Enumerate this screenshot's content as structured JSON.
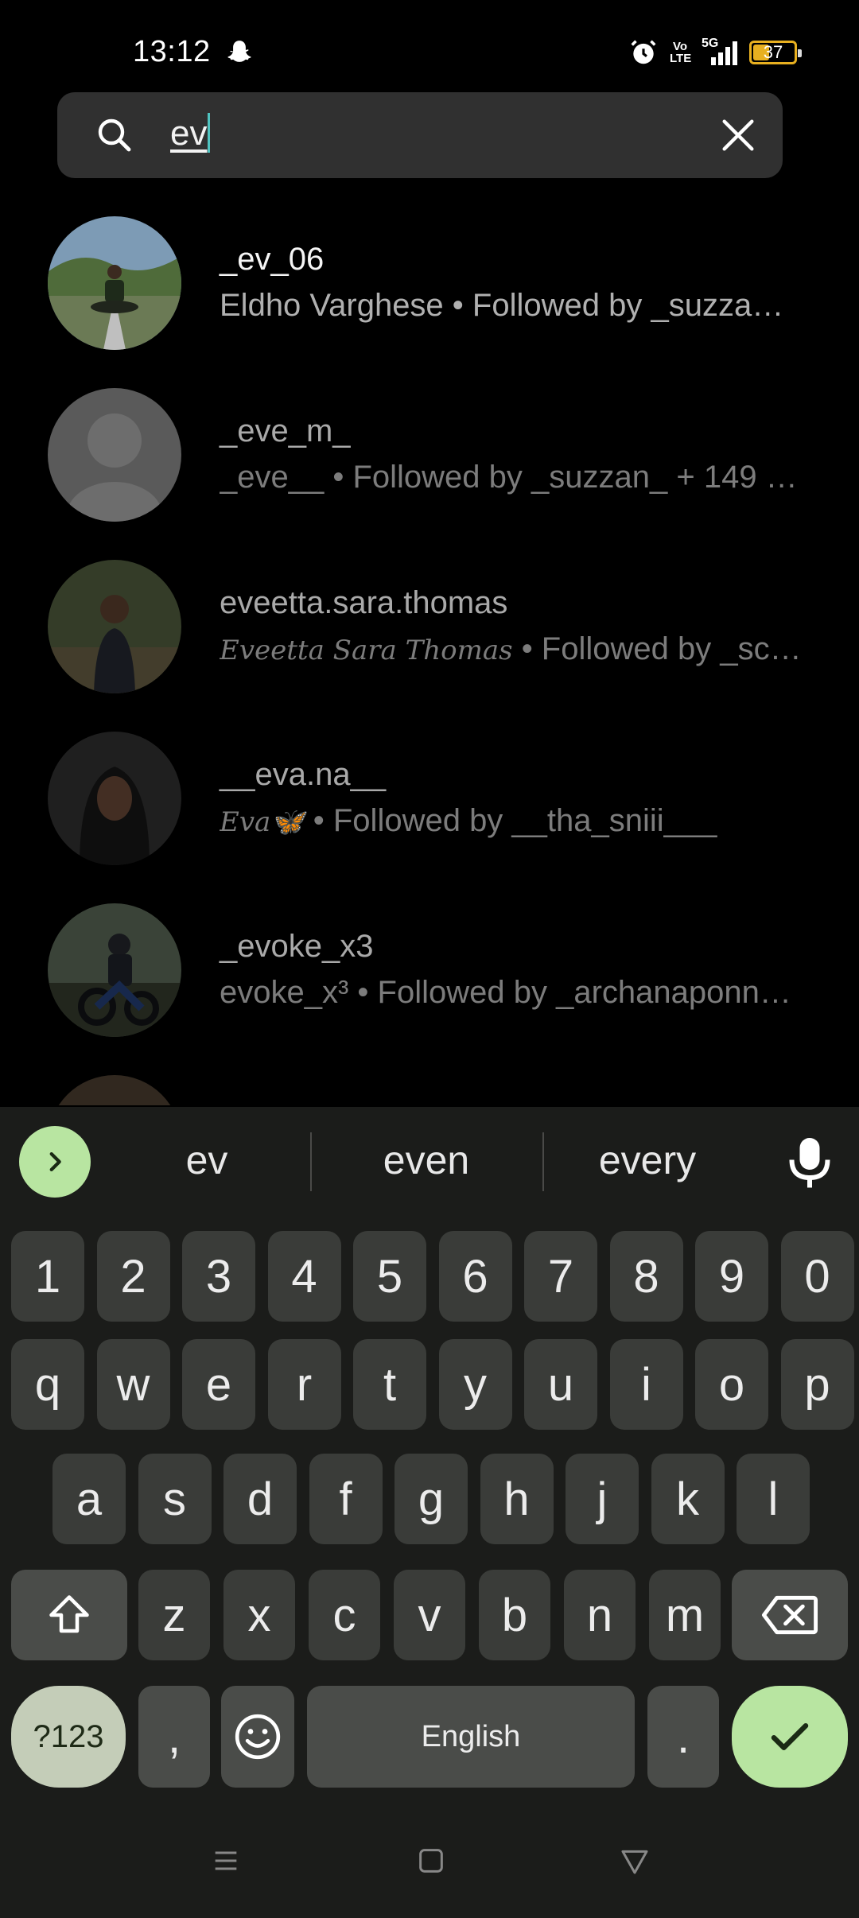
{
  "status_bar": {
    "time": "13:12",
    "battery": "37",
    "icons": [
      "snapchat-icon",
      "alarm-icon",
      "volte-icon",
      "5g-signal-icon",
      "battery-icon"
    ],
    "volte_line1": "Vo",
    "volte_line2": "LTE",
    "network": "5G"
  },
  "search": {
    "query": "ev"
  },
  "results": [
    {
      "username": "_ev_06",
      "subtitle": "Eldho Varghese • Followed by _suzza…"
    },
    {
      "username": "_eve_m_",
      "subtitle": "_eve__ • Followed by _suzzan_ + 149 …"
    },
    {
      "username": "eveetta.sara.thomas",
      "fullname": "Eveetta Sara Thomas",
      "subtitle": " • Followed by _sc_…"
    },
    {
      "username": "__eva.na__",
      "fullname": "Eva🦋",
      "subtitle": " • Followed by __tha_sniii___"
    },
    {
      "username": "_evoke_x3",
      "subtitle": "evoke_x³ • Followed by _archanaponn…"
    }
  ],
  "keyboard": {
    "suggestions": [
      "ev",
      "even",
      "every"
    ],
    "number_row": [
      "1",
      "2",
      "3",
      "4",
      "5",
      "6",
      "7",
      "8",
      "9",
      "0"
    ],
    "row1": [
      "q",
      "w",
      "e",
      "r",
      "t",
      "y",
      "u",
      "i",
      "o",
      "p"
    ],
    "row2": [
      "a",
      "s",
      "d",
      "f",
      "g",
      "h",
      "j",
      "k",
      "l"
    ],
    "row3": [
      "z",
      "x",
      "c",
      "v",
      "b",
      "n",
      "m"
    ],
    "symbols_label": "?123",
    "comma": ",",
    "space_label": "English",
    "period": ".",
    "accent_color": "#b8e5a1"
  }
}
